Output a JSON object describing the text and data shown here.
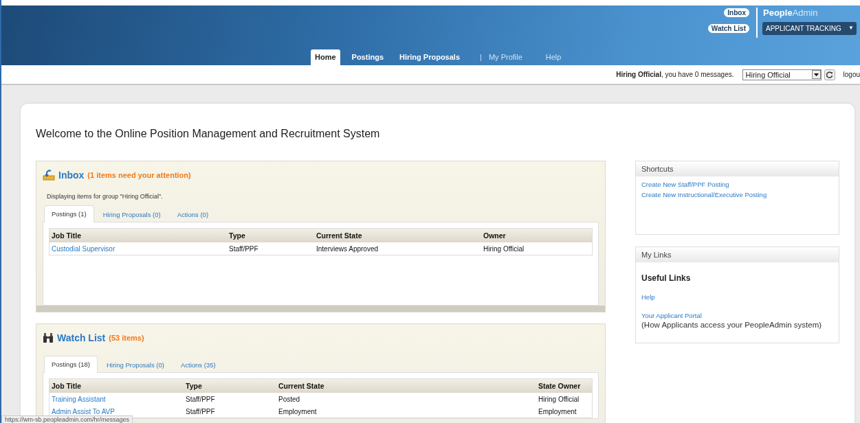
{
  "header": {
    "brand_bold": "People",
    "brand_light": "Admin",
    "quick_links": [
      "Inbox",
      "Watch List"
    ],
    "module_select": {
      "value": "APPLICANT TRACKING",
      "arrow": "▼"
    },
    "nav": [
      {
        "label": "Home",
        "kind": "primary",
        "selected": true
      },
      {
        "label": "Postings",
        "kind": "primary",
        "selected": false
      },
      {
        "label": "Hiring Proposals",
        "kind": "primary",
        "selected": false
      },
      {
        "label": "My Profile",
        "kind": "secondary",
        "selected": false
      },
      {
        "label": "Help",
        "kind": "secondary",
        "selected": false
      }
    ],
    "nav_separator": "|"
  },
  "user_bar": {
    "message": "**Hiring Official**, you have 0 messages.",
    "role_select": {
      "value": "Hiring Official"
    },
    "logout": "logou"
  },
  "page_title": "Welcome to the Online Position Management and Recruitment System",
  "inbox": {
    "title": "Inbox",
    "count_note": "(1 items need your attention)",
    "group_note": "Displaying items for group \"Hiring Official\".",
    "tabs": [
      {
        "label": "Postings (1)",
        "selected": true
      },
      {
        "label": "Hiring Proposals (0)",
        "selected": false
      },
      {
        "label": "Actions (0)",
        "selected": false
      }
    ],
    "columns": [
      "Job Title",
      "Type",
      "Current State",
      "Owner"
    ],
    "rows": [
      [
        "Custodial Supervisor",
        "Staff/PPF",
        "Interviews Approved",
        "Hiring Official"
      ]
    ]
  },
  "watch_list": {
    "title": "Watch List",
    "count_note": "(53 items)",
    "tabs": [
      {
        "label": "Postings (18)",
        "selected": true
      },
      {
        "label": "Hiring Proposals (0)",
        "selected": false
      },
      {
        "label": "Actions (35)",
        "selected": false
      }
    ],
    "columns": [
      "Job Title",
      "Type",
      "Current State",
      "State Owner"
    ],
    "rows": [
      [
        "Training Assistant",
        "Staff/PPF",
        "Posted",
        "Hiring Official"
      ],
      [
        "Admin Assist To AVP",
        "Staff/PPF",
        "Employment",
        "Employment"
      ]
    ]
  },
  "shortcuts": {
    "title": "Shortcuts",
    "links": [
      "Create New Staff/PPF Posting",
      "Create New Instructional/Executive Posting"
    ]
  },
  "my_links": {
    "title": "My Links",
    "heading": "Useful Links",
    "links": [
      {
        "label": "Help"
      },
      {
        "label": "Your Applicant Portal",
        "note": "(How Applicants access your PeopleAdmin system)"
      }
    ]
  },
  "status_url": "https://wm-sb.peopleadmin.com/hr/messages"
}
